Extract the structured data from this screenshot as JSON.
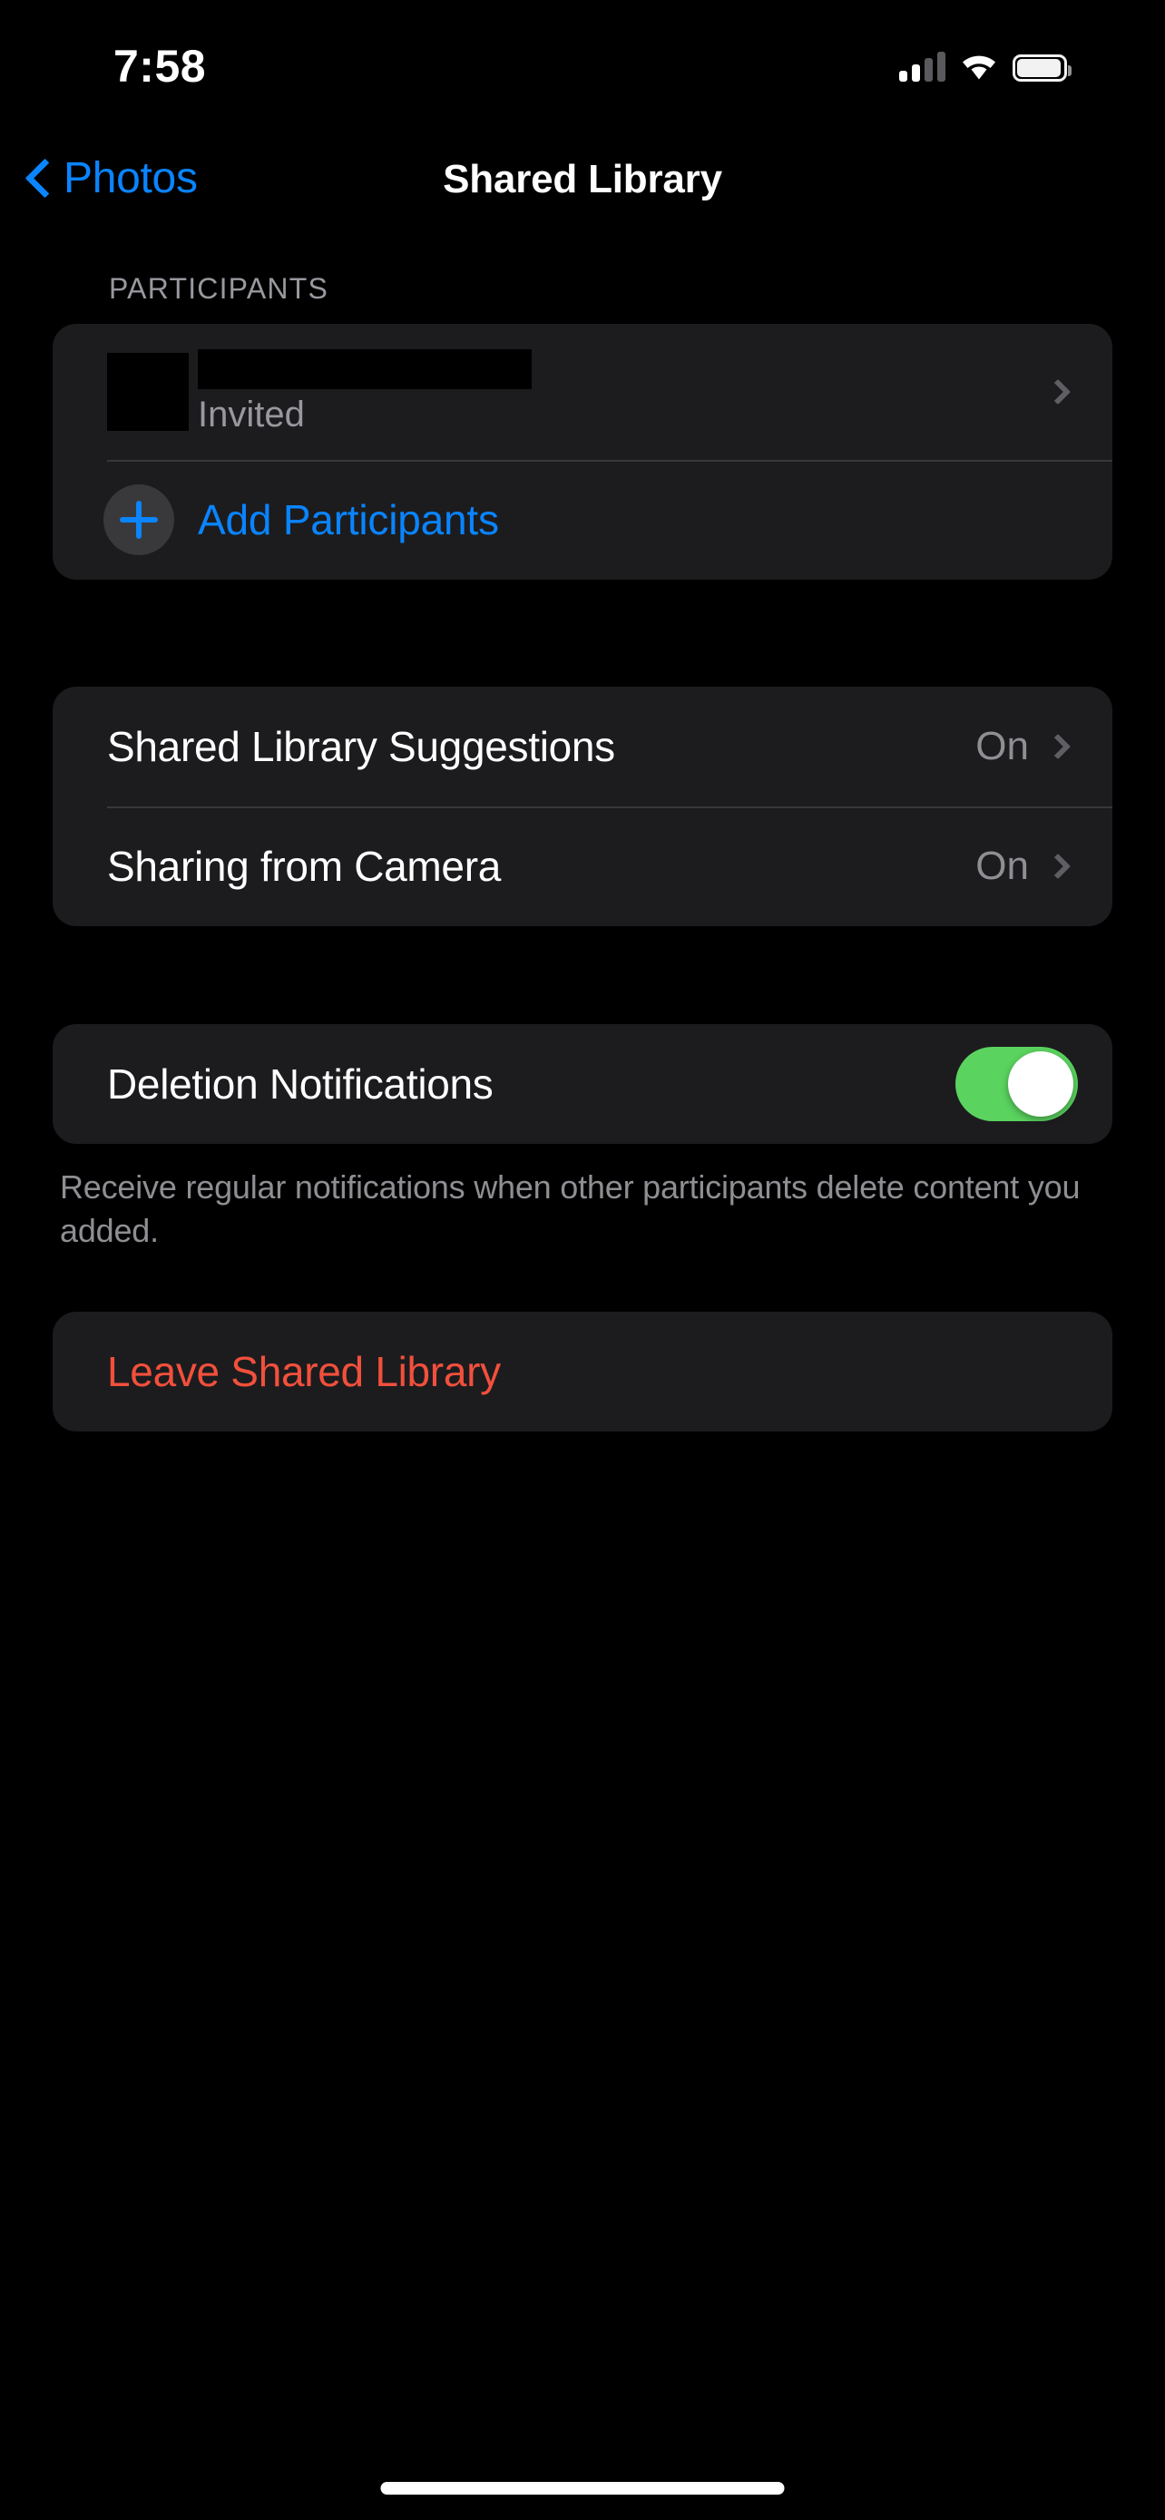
{
  "status_bar": {
    "time": "7:58",
    "cellular_icon": "cellular-signal-icon",
    "cellular_bars_filled": 2,
    "cellular_bars_total": 4,
    "wifi_icon": "wifi-icon",
    "battery_icon": "battery-full-icon"
  },
  "nav": {
    "back_label": "Photos",
    "back_icon": "chevron-left-icon",
    "title": "Shared Library"
  },
  "participants": {
    "header": "PARTICIPANTS",
    "member": {
      "name": "",
      "status": "Invited",
      "avatar": "",
      "disclosure_icon": "chevron-right-icon"
    },
    "add": {
      "label": "Add Participants",
      "icon": "plus-circle-icon"
    }
  },
  "settings": {
    "rows": [
      {
        "label": "Shared Library Suggestions",
        "value": "On",
        "disclosure_icon": "chevron-right-icon"
      },
      {
        "label": "Sharing from Camera",
        "value": "On",
        "disclosure_icon": "chevron-right-icon"
      }
    ]
  },
  "deletion": {
    "label": "Deletion Notifications",
    "toggle_state": "on",
    "footnote": "Receive regular notifications when other participants delete content you added."
  },
  "leave": {
    "label": "Leave Shared Library"
  },
  "colors": {
    "accent_blue": "#0a84ff",
    "destructive_red": "#f2503c",
    "toggle_green": "#5ad35f",
    "card_bg": "#1c1c1e",
    "page_bg": "#000000",
    "secondary_text": "#8e8e93"
  }
}
